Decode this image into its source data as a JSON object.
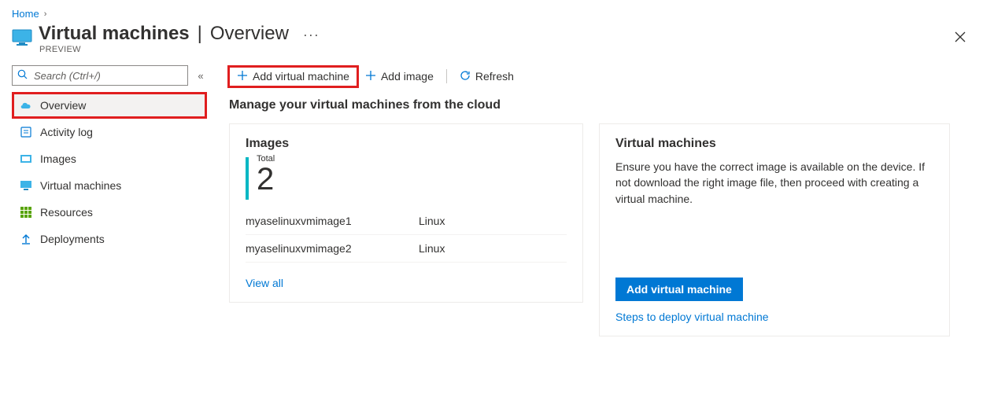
{
  "breadcrumb": {
    "home": "Home"
  },
  "header": {
    "title_bold": "Virtual machines",
    "title_sep": "|",
    "title_light": "Overview",
    "preview": "PREVIEW"
  },
  "sidebar": {
    "search_placeholder": "Search (Ctrl+/)",
    "items": [
      {
        "label": "Overview"
      },
      {
        "label": "Activity log"
      },
      {
        "label": "Images"
      },
      {
        "label": "Virtual machines"
      },
      {
        "label": "Resources"
      },
      {
        "label": "Deployments"
      }
    ]
  },
  "toolbar": {
    "add_vm": "Add virtual machine",
    "add_image": "Add image",
    "refresh": "Refresh"
  },
  "main": {
    "heading": "Manage your virtual machines from the cloud"
  },
  "images_card": {
    "title": "Images",
    "total_label": "Total",
    "total_value": "2",
    "rows": [
      {
        "name": "myaselinuxvmimage1",
        "os": "Linux"
      },
      {
        "name": "myaselinuxvmimage2",
        "os": "Linux"
      }
    ],
    "view_all": "View all"
  },
  "vms_card": {
    "title": "Virtual machines",
    "description": "Ensure you have the correct image is available on the device. If not download the right image file, then proceed with creating a virtual machine.",
    "button": "Add virtual machine",
    "link": "Steps to deploy virtual machine"
  }
}
